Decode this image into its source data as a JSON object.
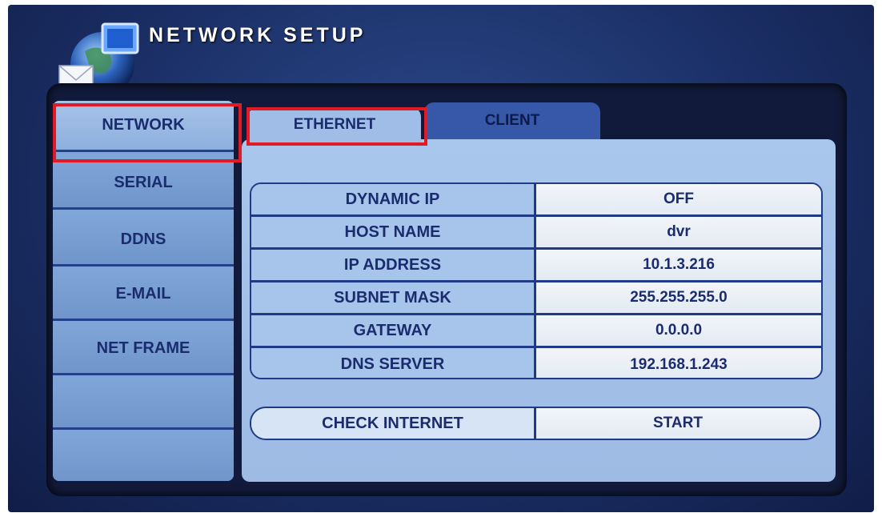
{
  "header": {
    "title": "NETWORK SETUP"
  },
  "sidebar": {
    "items": [
      {
        "label": "NETWORK"
      },
      {
        "label": "SERIAL"
      },
      {
        "label": "DDNS"
      },
      {
        "label": "E-MAIL"
      },
      {
        "label": "NET FRAME"
      },
      {
        "label": ""
      },
      {
        "label": ""
      }
    ],
    "active": "NETWORK"
  },
  "tabs": [
    {
      "label": "ETHERNET",
      "active": true
    },
    {
      "label": "CLIENT",
      "active": false
    }
  ],
  "settings": [
    {
      "label": "DYNAMIC IP",
      "value": "OFF"
    },
    {
      "label": "HOST NAME",
      "value": "dvr"
    },
    {
      "label": "IP ADDRESS",
      "value": "10.1.3.216"
    },
    {
      "label": "SUBNET MASK",
      "value": "255.255.255.0"
    },
    {
      "label": "GATEWAY",
      "value": "0.0.0.0"
    },
    {
      "label": "DNS SERVER",
      "value": "192.168.1.243"
    }
  ],
  "check": {
    "label": "CHECK INTERNET",
    "action": "START"
  },
  "icons": {
    "logo": "globe-envelope-monitor-icon"
  },
  "colors": {
    "highlight": "#e01b24",
    "background": "#1b2f66",
    "panel": "#a9c6ec"
  }
}
